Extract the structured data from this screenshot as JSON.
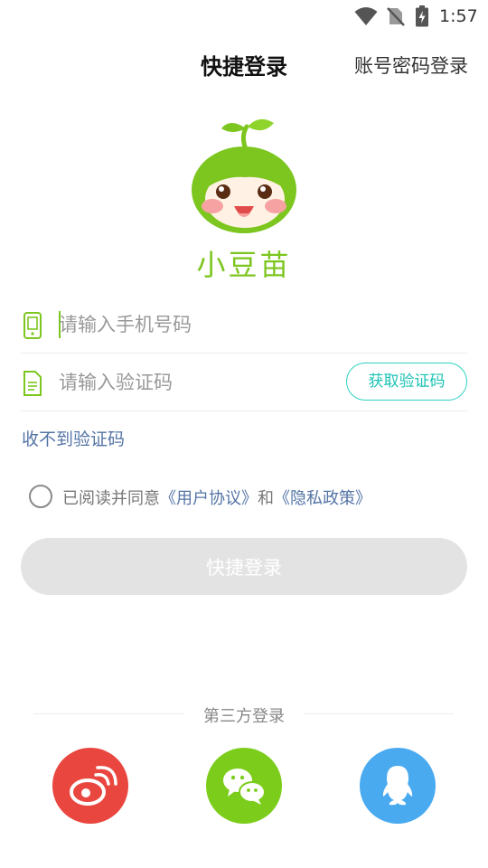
{
  "status_bar": {
    "time": "1:57"
  },
  "header": {
    "title": "快捷登录",
    "alt_login": "账号密码登录"
  },
  "brand": {
    "name": "小豆苗"
  },
  "form": {
    "phone_placeholder": "请输入手机号码",
    "code_placeholder": "请输入验证码",
    "get_code_label": "获取验证码",
    "no_code_label": "收不到验证码"
  },
  "agreement": {
    "prefix": "已阅读并同意",
    "user_agreement": "《用户协议》",
    "and": "和",
    "privacy_policy": "《隐私政策》"
  },
  "login_button": "快捷登录",
  "third_party": {
    "label": "第三方登录",
    "providers": [
      {
        "name": "weibo",
        "icon": "weibo-icon",
        "color": "#e9463f"
      },
      {
        "name": "wechat",
        "icon": "wechat-icon",
        "color": "#7ccd1b"
      },
      {
        "name": "qq",
        "icon": "qq-icon",
        "color": "#4aaaf0"
      }
    ]
  },
  "colors": {
    "brand_green": "#7cc61f",
    "accent_teal": "#19c3b3",
    "link_blue": "#5474a6",
    "disabled_button": "#e3e3e3"
  }
}
